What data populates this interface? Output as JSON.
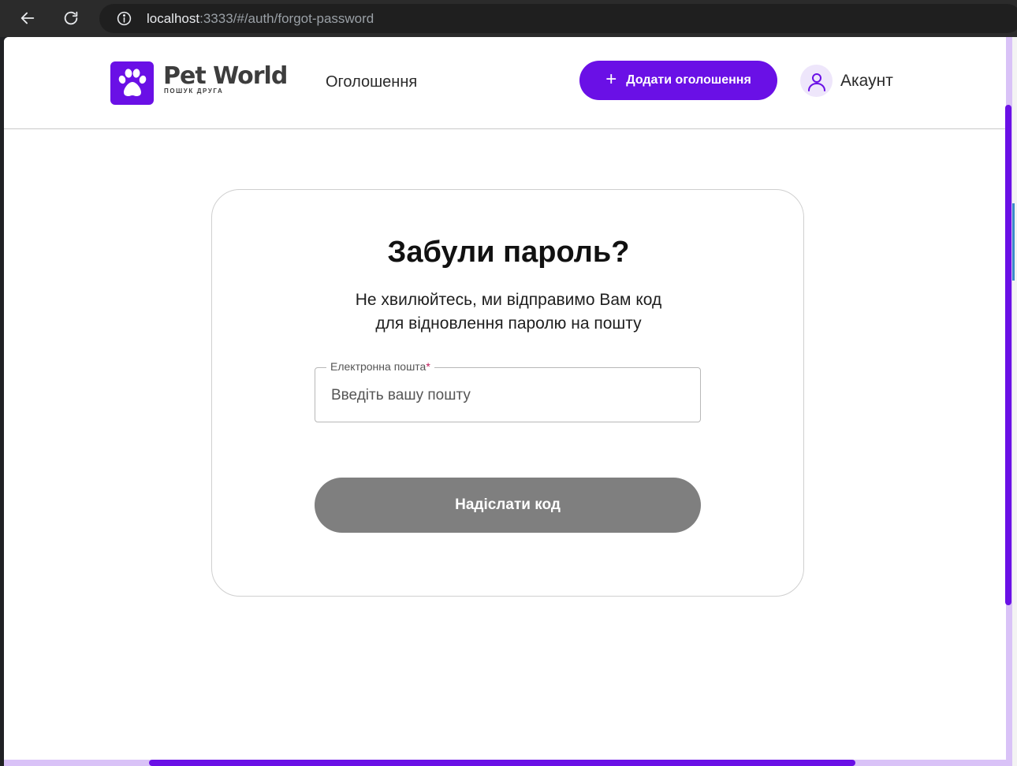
{
  "browser": {
    "url_host": "localhost",
    "url_rest": ":3333/#/auth/forgot-password"
  },
  "header": {
    "logo_name": "Pet World",
    "logo_tagline": "ПОШУК ДРУГА",
    "nav_listings": "Оголошення",
    "add_listing_icon": "+",
    "add_listing_label": "Додати оголошення",
    "account_label": "Акаунт"
  },
  "form": {
    "title": "Забули пароль?",
    "subtitle_line1": "Не хвилюйтесь, ми відправимо Вам код",
    "subtitle_line2": "для відновлення паролю на пошту",
    "email_label": "Електронна пошта",
    "email_required_mark": "*",
    "email_placeholder": "Введіть вашу пошту",
    "email_value": "",
    "submit_label": "Надіслати код"
  },
  "icons": {
    "back": "arrow-left-icon",
    "reload": "reload-icon",
    "site_info": "info-icon",
    "logo": "paw-icon",
    "account": "user-icon"
  },
  "colors": {
    "brand": "#6a10e6",
    "button_disabled": "#7f7f7f",
    "required": "#c2185b"
  }
}
